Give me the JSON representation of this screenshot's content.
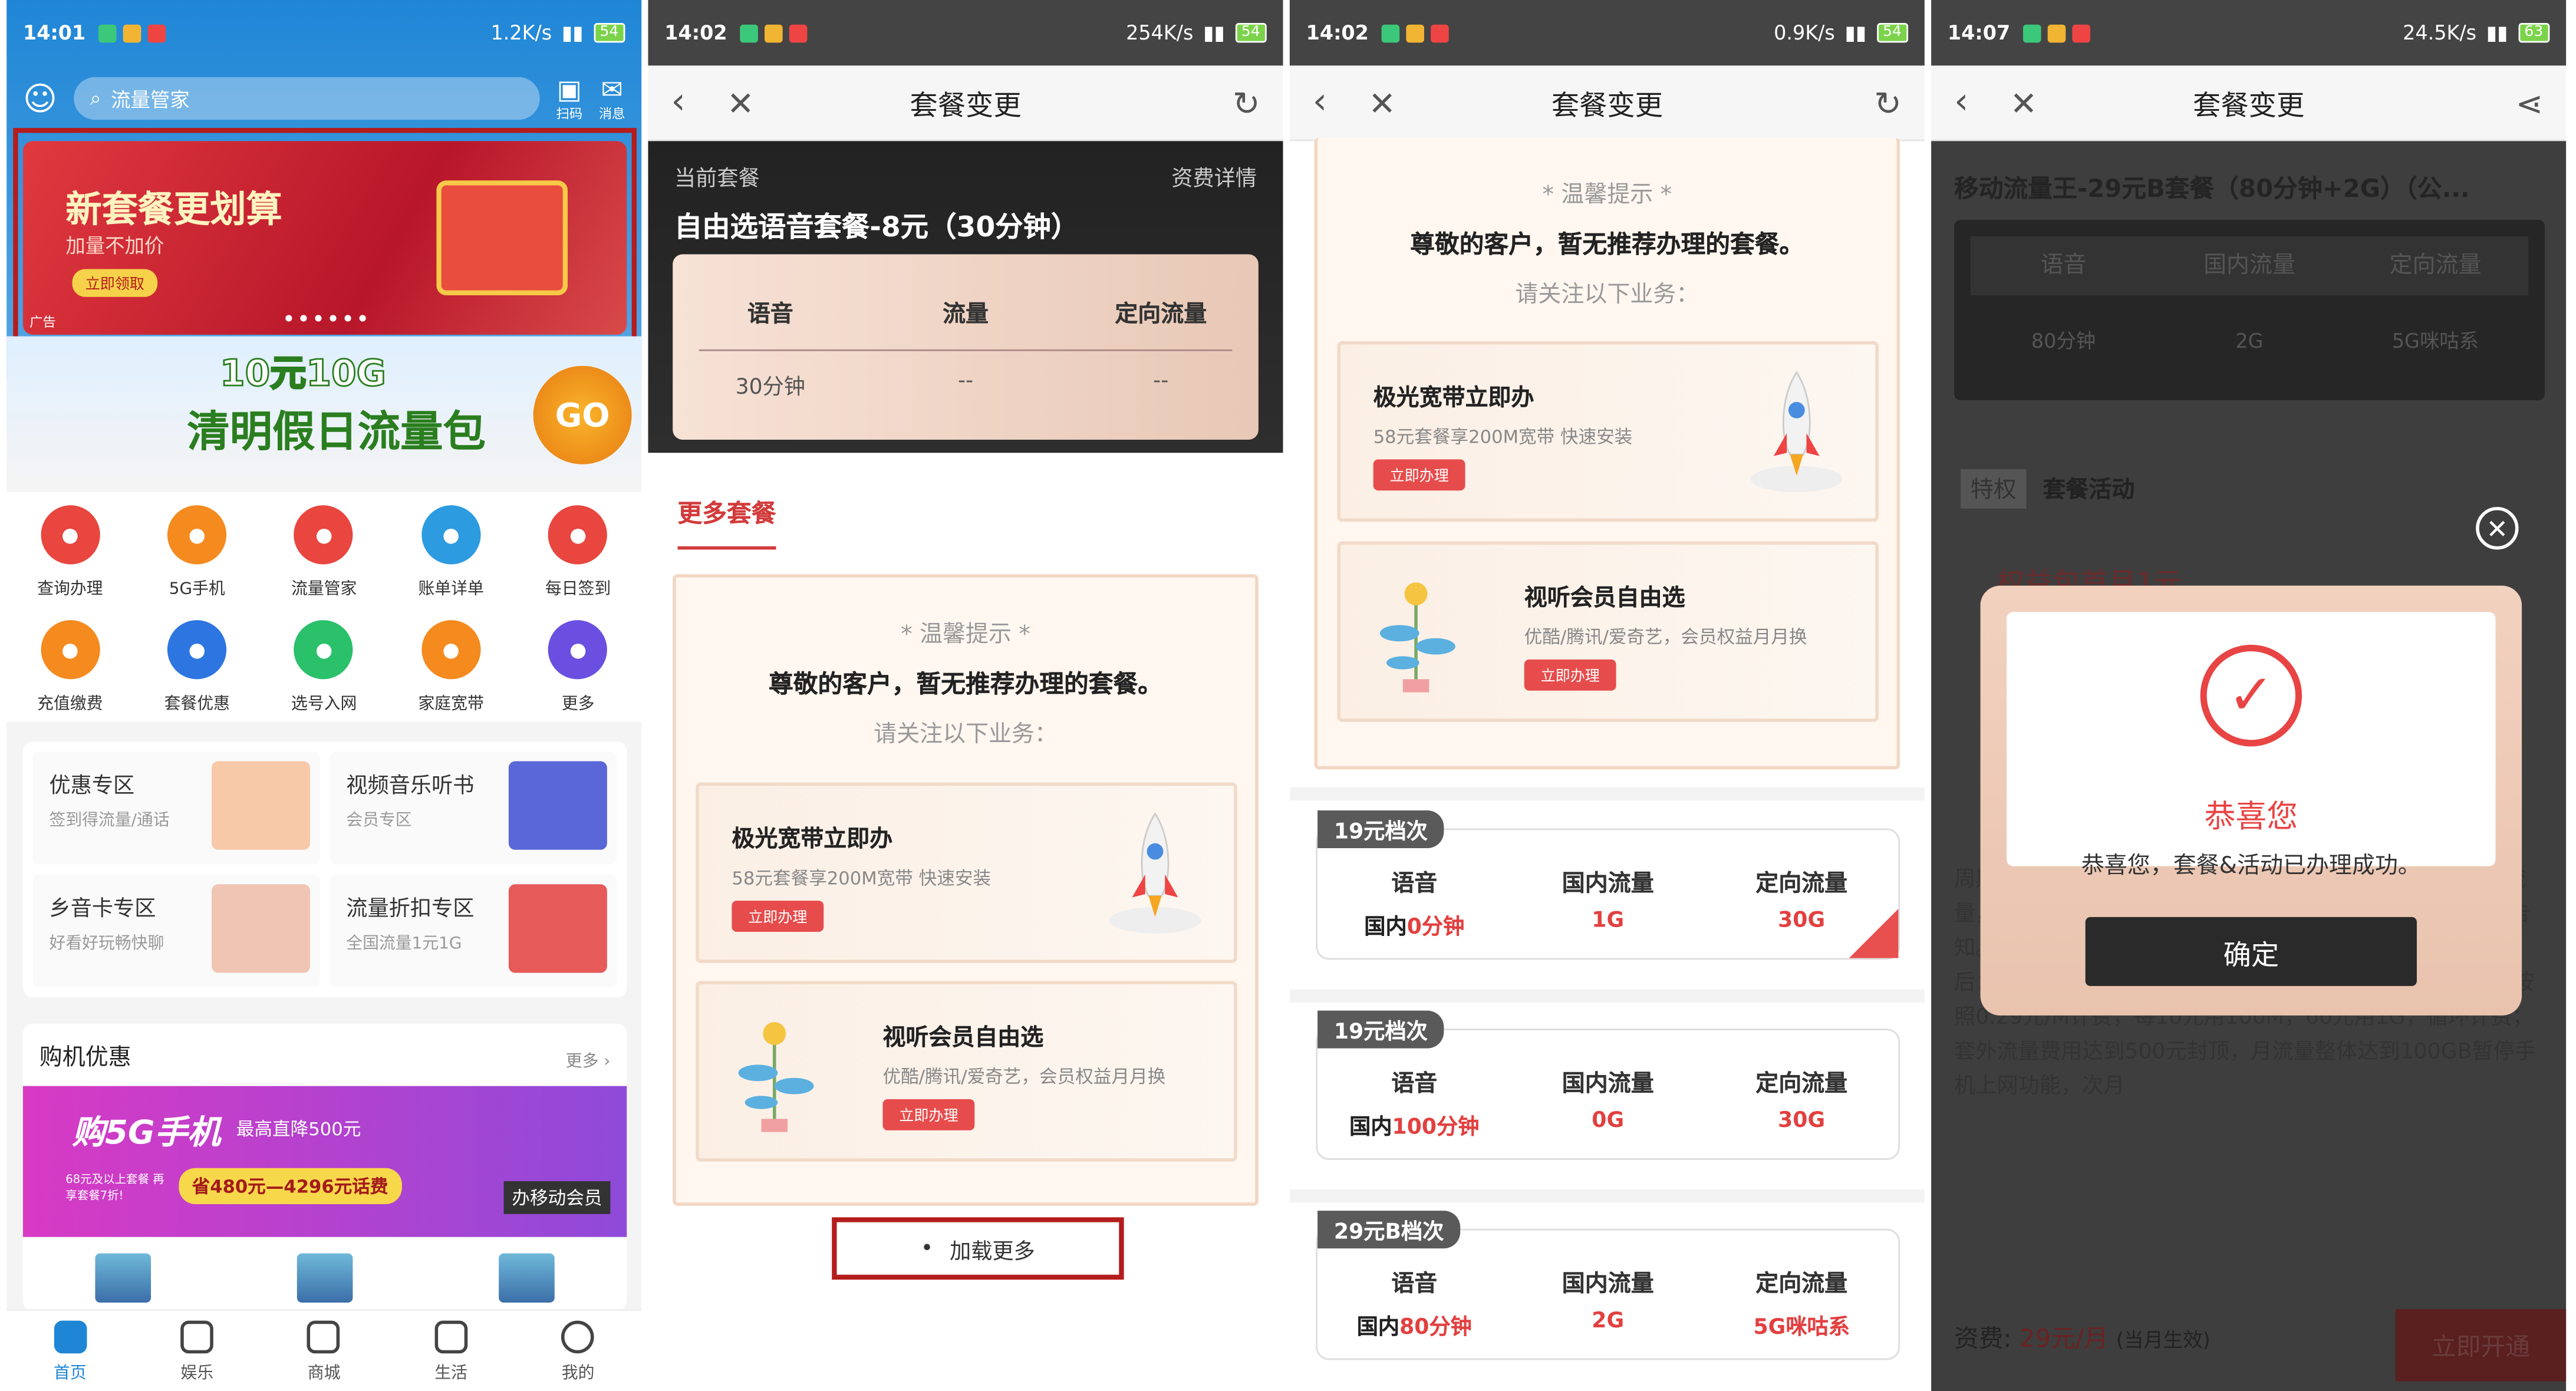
{
  "panel1": {
    "status": {
      "time": "14:01",
      "speed": "1.2K/s",
      "battery": "54"
    },
    "search_placeholder": "流量管家",
    "scan_label": "扫码",
    "msg_label": "消息",
    "banner": {
      "title": "新套餐更划算",
      "subtitle": "加量不加价",
      "button": "立即领取",
      "ad": "广告"
    },
    "promo": {
      "top": "10元10G",
      "main": "清明假日流量包",
      "go": "GO"
    },
    "grid": [
      {
        "label": "查询办理",
        "color": "#e8463f"
      },
      {
        "label": "5G手机",
        "color": "#f58a1f"
      },
      {
        "label": "流量管家",
        "color": "#e8463f"
      },
      {
        "label": "账单详单",
        "color": "#2d9be0"
      },
      {
        "label": "每日签到",
        "color": "#e8463f"
      },
      {
        "label": "充值缴费",
        "color": "#f58a1f"
      },
      {
        "label": "套餐优惠",
        "color": "#2d75e0"
      },
      {
        "label": "选号入网",
        "color": "#2bc06a"
      },
      {
        "label": "家庭宽带",
        "color": "#f58a1f"
      },
      {
        "label": "更多",
        "color": "#6a4fe0"
      }
    ],
    "zones": [
      {
        "title": "优惠专区",
        "sub": "签到得流量/通话"
      },
      {
        "title": "视频音乐听书",
        "sub": "会员专区"
      },
      {
        "title": "乡音卡专区",
        "sub": "好看好玩畅快聊"
      },
      {
        "title": "流量折扣专区",
        "sub": "全国流量1元1G"
      }
    ],
    "shop": {
      "title": "购机优惠",
      "more": "更多",
      "ban1": "购5G手机",
      "ban2": "最高直降500元",
      "ban3": "省480元—4296元话费",
      "ban4": "办移动会员",
      "ban5": "68元及以上套餐 再享套餐7折!"
    },
    "tabs": [
      "首页",
      "娱乐",
      "商城",
      "生活",
      "我的"
    ]
  },
  "panel2": {
    "status": {
      "time": "14:02",
      "speed": "254K/s",
      "battery": "54"
    },
    "title": "套餐变更",
    "current_label": "当前套餐",
    "detail_label": "资费详情",
    "plan_name": "自由选语音套餐-8元（30分钟）",
    "heads": [
      "语音",
      "流量",
      "定向流量"
    ],
    "vals": [
      "30分钟",
      "--",
      "--"
    ],
    "more_tab": "更多套餐",
    "tip_star": "* 温馨提示 *",
    "tip_msg": "尊敬的客户，暂无推荐办理的套餐。",
    "tip_att": "请关注以下业务：",
    "svc1": {
      "title": "极光宽带立即办",
      "desc": "58元套餐享200M宽带 快速安装",
      "btn": "立即办理"
    },
    "svc2": {
      "title": "视听会员自由选",
      "desc": "优酷/腾讯/爱奇艺，会员权益月月换",
      "btn": "立即办理"
    },
    "loadmore": "加载更多"
  },
  "panel3": {
    "status": {
      "time": "14:02",
      "speed": "0.9K/s",
      "battery": "54"
    },
    "title": "套餐变更",
    "plans": [
      {
        "tag": "19元档次",
        "pre": "国内",
        "voice": "0分钟",
        "data": "1G",
        "targ": "30G",
        "checked": true
      },
      {
        "tag": "19元档次",
        "pre": "国内",
        "voice": "100分钟",
        "data": "0G",
        "targ": "30G",
        "checked": false
      },
      {
        "tag": "29元B档次",
        "pre": "国内",
        "voice": "80分钟",
        "data": "2G",
        "targ": "5G咪咕系",
        "checked": false
      }
    ],
    "heads": [
      "语音",
      "国内流量",
      "定向流量"
    ]
  },
  "panel4": {
    "status": {
      "time": "14:07",
      "speed": "24.5K/s",
      "battery": "63"
    },
    "title": "套餐变更",
    "plan_name": "移动流量王-29元B套餐（80分钟+2G）（公...",
    "heads": [
      "语音",
      "国内流量",
      "定向流量"
    ],
    "vals": [
      "80分钟",
      "2G",
      "5G咪咕系"
    ],
    "tequan": "特权",
    "activity": "套餐活动",
    "rights": "权益包首月1元",
    "long_text": "周期内，每月可免费获赠1748M国内流量和5G咪咕系定向流量，仅限当月使用。若下个周期优惠赠送调整，将提前短信告知。转出套餐，该优惠赠送取消。3、超过套餐包含通话时长后：直接拨打国内电话0.19元/分钟。4、流量超出套餐后，按照0.29元/M计费，每10元用100M，60元用1G，循环计费；套外流量费用达到500元封顶，月流量整体达到100GB暂停手机上网功能，次月",
    "price_label": "资费:",
    "price": "29元/月",
    "price_note": "(当月生效)",
    "open": "立即开通",
    "modal": {
      "title": "恭喜您",
      "desc": "恭喜您，套餐&活动已办理成功。",
      "ok": "确定"
    }
  }
}
